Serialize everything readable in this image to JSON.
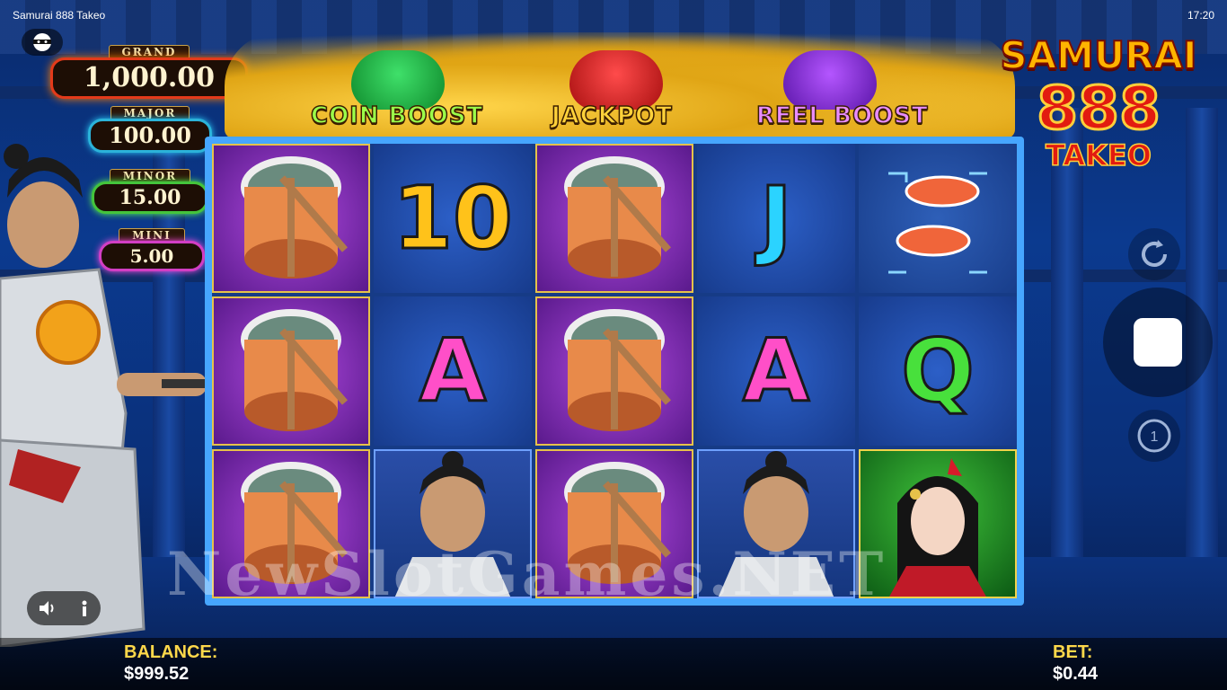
{
  "window": {
    "title": "Samurai 888 Takeo",
    "clock": "17:20"
  },
  "jackpots": [
    {
      "label": "GRAND",
      "value": "1,000.00"
    },
    {
      "label": "MAJOR",
      "value": "100.00"
    },
    {
      "label": "MINOR",
      "value": "15.00"
    },
    {
      "label": "MINI",
      "value": "5.00"
    }
  ],
  "features": {
    "coin_boost": "COIN BOOST",
    "jackpot": "JACKPOT",
    "reel_boost": "REEL BOOST"
  },
  "logo": {
    "line1": "SAMURAI",
    "line2": "888",
    "line3": "TAKEO"
  },
  "reels": [
    [
      "drum",
      "drum",
      "drum"
    ],
    [
      "10",
      "A",
      "samurai"
    ],
    [
      "drum",
      "drum",
      "drum"
    ],
    [
      "J",
      "A",
      "samurai"
    ],
    [
      "koi",
      "Q",
      "geisha"
    ]
  ],
  "symbols": {
    "ten": "10",
    "j": "J",
    "a": "A",
    "q": "Q"
  },
  "balance": {
    "label": "BALANCE:",
    "value": "$999.52"
  },
  "bet": {
    "label": "BET:",
    "value": "$0.44"
  },
  "bet_level": "1",
  "watermark": "NewSlotGames.NET",
  "colors": {
    "accent_gold": "#ffd84a",
    "reel_frame": "#46a6ff",
    "drum_bg": "#5a1a8c"
  }
}
